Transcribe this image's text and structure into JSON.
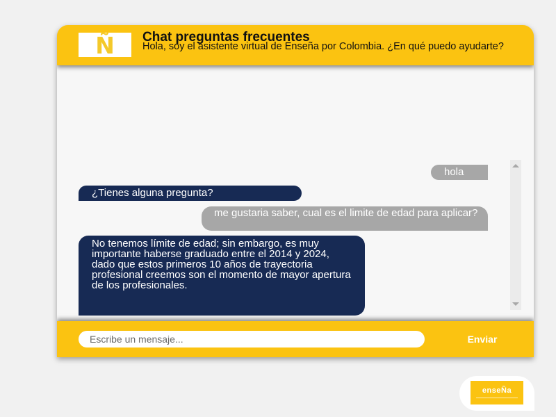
{
  "header": {
    "logo_glyph": "Ñ",
    "title": "Chat preguntas frecuentes",
    "subtitle": "Hola, soy el asistente virtual de Enseña por Colombia. ¿En qué puedo ayudarte?"
  },
  "messages": [
    {
      "sender": "user",
      "text": "hola"
    },
    {
      "sender": "bot",
      "text": "¿Tienes alguna pregunta?"
    },
    {
      "sender": "user",
      "text": "me gustaria saber, cual es el limite de edad para aplicar?"
    },
    {
      "sender": "bot",
      "text": "No tenemos límite de edad; sin embargo, es muy importante haberse graduado entre el 2014 y 2024, dado que estos primeros 10 años de trayectoria profesional creemos son el momento de mayor apertura de los profesionales."
    }
  ],
  "footer": {
    "input_value": "",
    "input_placeholder": "Escribe un mensaje...",
    "send_label": "Enviar"
  },
  "launcher": {
    "logo_text": "enseÑa"
  },
  "colors": {
    "brand_yellow": "#fbc311",
    "bot_bubble": "#172a54",
    "user_bubble": "#a7a7a7"
  },
  "icons": [
    "enseña-logo-icon",
    "scroll-up-icon",
    "scroll-down-icon"
  ]
}
